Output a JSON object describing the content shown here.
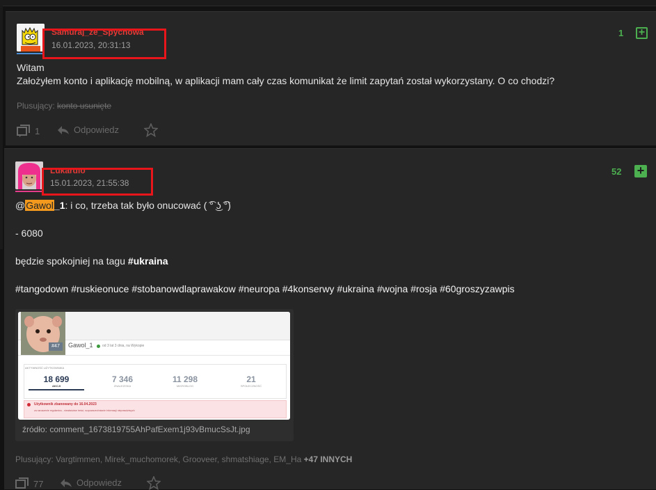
{
  "post1": {
    "author": "Samuraj_ze_Spychowa",
    "date": "16.01.2023, 20:31:13",
    "votes": "1",
    "line1": "Witam",
    "line2": "Założyłem konto i aplikację mobilną, w aplikacji mam cały czas komunikat że limit zapytań został wykorzystany. O co chodzi?",
    "voters_label": "Plusujący:",
    "voters_value": "konto usunięte",
    "comments_count": "1",
    "reply_label": "Odpowiedz"
  },
  "post2": {
    "author": "Lukardio",
    "date": "15.01.2023, 21:55:38",
    "votes": "52",
    "mention_at": "@",
    "mention_hl": "Gawol",
    "mention_rest": "_1",
    "reply_text": ": i co, trzeba tak było onucować ( ͡° ͜ʖ ͡°)",
    "line_score": "- 6080",
    "line_calm": "będzie spokojniej na tagu",
    "tag_ukraina": "#ukraina",
    "tags": [
      "#tangodown",
      "#ruskieonuce",
      "#stobanowdlaprawakow",
      "#neuropa",
      "#4konserwy",
      "#ukraina",
      "#wojna",
      "#rosja",
      "#60groszyzawpis"
    ],
    "source_label": "źródło: comment_1673819755AhPafExem1j93vBmucSsJt.jpg",
    "voters_label": "Plusujący:",
    "voters_value": "Vargtimmen, Mirek_muchomorek, Grooveer, shmatshiage, EM_Ha",
    "voters_more": "+47 INNYCH",
    "comments_count": "77",
    "reply_label": "Odpowiedz"
  },
  "embed": {
    "username": "Gawol_1",
    "rank": "#47",
    "status": "od 3 lat 3 dnia, na Wykopie",
    "section": "AKTYWNOŚĆ UŻYTKOWNIKA",
    "stats": [
      {
        "value": "18 699",
        "label": "AKCJI"
      },
      {
        "value": "7 346",
        "label": "ZNALEZISKA"
      },
      {
        "value": "11 298",
        "label": "MIKROBLOG"
      },
      {
        "value": "21",
        "label": "SPOŁECZNOŚĆ"
      }
    ],
    "ban_title": "Użytkownik zbanowany do 16.04.2023",
    "ban_reason": "za naruszenie regulaminu - niewłaściwe treści, rozpowszechnianie informacji nieprawdziwych"
  },
  "colors": {
    "vote_green": "#4caf50",
    "author_red": "#e53935",
    "highlight": "#e8151b",
    "mention_bg": "#f39a1e"
  }
}
